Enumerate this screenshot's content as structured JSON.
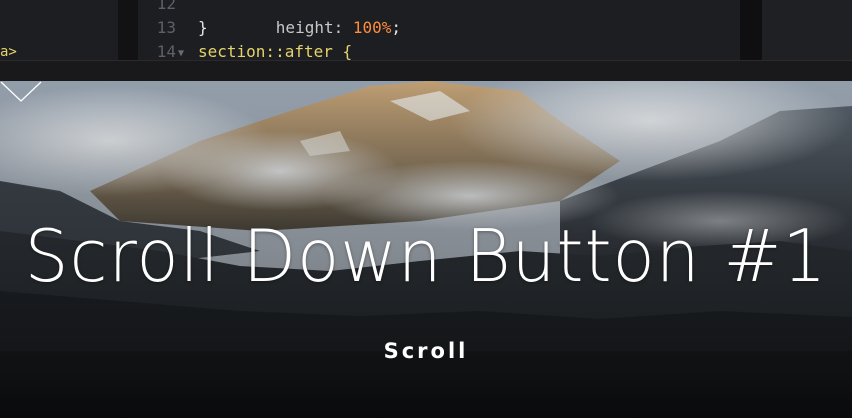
{
  "editor": {
    "left_fragment": "a>",
    "line_numbers": [
      "12",
      "13",
      "14"
    ],
    "lines": {
      "line12_prop": "height: ",
      "line12_value": "100%",
      "line12_end": ";",
      "line13": "}",
      "line14_selector": "section::after {"
    }
  },
  "preview": {
    "title": "Scroll Down Button #1",
    "scroll_label": "Scroll"
  },
  "colors": {
    "editor_bg": "#1d1e22",
    "number_token": "#ff8c3a",
    "selector_token": "#e6d36a"
  }
}
